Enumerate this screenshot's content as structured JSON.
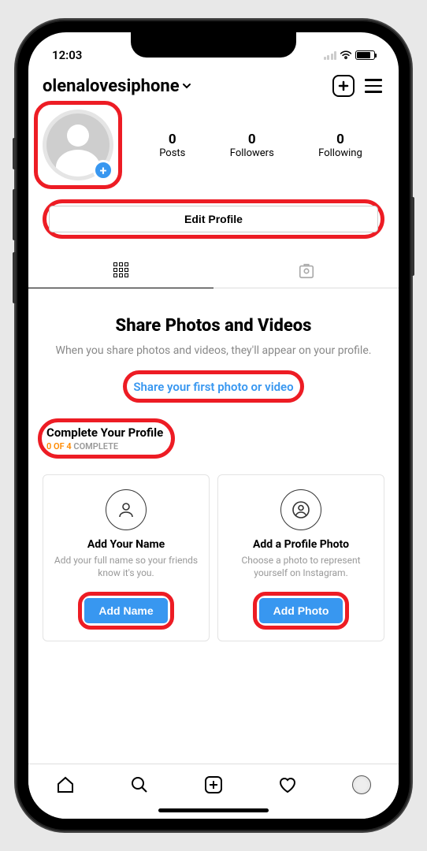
{
  "status": {
    "time": "12:03"
  },
  "header": {
    "username": "olenalovesiphone"
  },
  "profile": {
    "posts_count": "0",
    "posts_label": "Posts",
    "followers_count": "0",
    "followers_label": "Followers",
    "following_count": "0",
    "following_label": "Following",
    "edit_button": "Edit Profile"
  },
  "empty_state": {
    "title": "Share Photos and Videos",
    "subtitle": "When you share photos and videos, they'll appear on your profile.",
    "link": "Share your first photo or video"
  },
  "complete": {
    "title": "Complete Your Profile",
    "progress_done": "0 OF 4",
    "progress_label": " COMPLETE"
  },
  "cards": [
    {
      "title": "Add Your Name",
      "subtitle": "Add your full name so your friends know it's you.",
      "button": "Add Name"
    },
    {
      "title": "Add a Profile Photo",
      "subtitle": "Choose a photo to represent yourself on Instagram.",
      "button": "Add Photo"
    }
  ]
}
